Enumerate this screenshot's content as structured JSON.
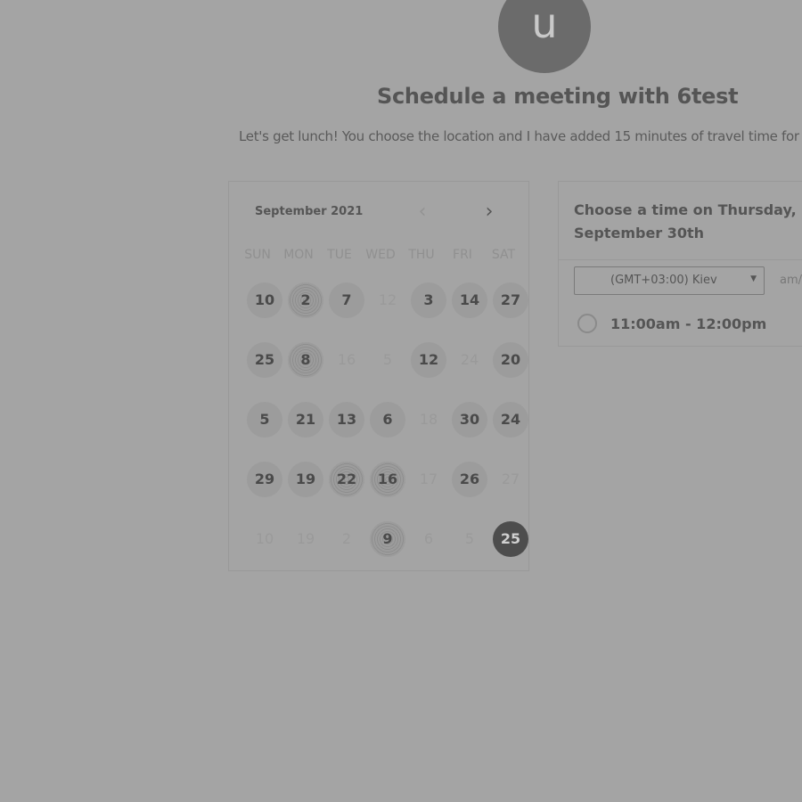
{
  "header": {
    "avatar_initial": "u",
    "title": "Schedule a meeting with 6test",
    "subtitle": "Let's get lunch! You choose the location and I have added 15 minutes of travel time for"
  },
  "calendar": {
    "month_label": "September 2021",
    "prev_icon": "chevron-left-icon",
    "next_icon": "chevron-right-icon",
    "weekdays": [
      "SUN",
      "MON",
      "TUE",
      "WED",
      "THU",
      "FRI",
      "SAT"
    ],
    "weeks": [
      [
        {
          "d": "10",
          "s": "avail"
        },
        {
          "d": "2",
          "s": "dotted"
        },
        {
          "d": "7",
          "s": "avail"
        },
        {
          "d": "12",
          "s": "off"
        },
        {
          "d": "3",
          "s": "avail"
        },
        {
          "d": "14",
          "s": "avail"
        },
        {
          "d": "27",
          "s": "avail"
        }
      ],
      [
        {
          "d": "25",
          "s": "avail"
        },
        {
          "d": "8",
          "s": "dotted"
        },
        {
          "d": "16",
          "s": "off"
        },
        {
          "d": "5",
          "s": "off"
        },
        {
          "d": "12",
          "s": "avail"
        },
        {
          "d": "24",
          "s": "off"
        },
        {
          "d": "20",
          "s": "avail"
        }
      ],
      [
        {
          "d": "5",
          "s": "avail"
        },
        {
          "d": "21",
          "s": "avail"
        },
        {
          "d": "13",
          "s": "avail"
        },
        {
          "d": "6",
          "s": "avail"
        },
        {
          "d": "18",
          "s": "off"
        },
        {
          "d": "30",
          "s": "avail"
        },
        {
          "d": "24",
          "s": "avail"
        }
      ],
      [
        {
          "d": "29",
          "s": "avail"
        },
        {
          "d": "19",
          "s": "avail"
        },
        {
          "d": "22",
          "s": "dotted"
        },
        {
          "d": "16",
          "s": "dotted"
        },
        {
          "d": "17",
          "s": "off"
        },
        {
          "d": "26",
          "s": "avail"
        },
        {
          "d": "27",
          "s": "off"
        }
      ],
      [
        {
          "d": "10",
          "s": "off"
        },
        {
          "d": "19",
          "s": "off"
        },
        {
          "d": "2",
          "s": "off"
        },
        {
          "d": "9",
          "s": "dotted"
        },
        {
          "d": "6",
          "s": "off"
        },
        {
          "d": "5",
          "s": "off"
        },
        {
          "d": "25",
          "s": "selected"
        }
      ]
    ]
  },
  "times": {
    "title": "Choose a time on Thursday, September 30th",
    "timezone": "(GMT+03:00) Kiev",
    "format_label": "am/",
    "slots": [
      {
        "label": "11:00am - 12:00pm"
      }
    ]
  },
  "colors": {
    "background": "#a4a4a4",
    "selected_day": "#4d4d4d",
    "available_day": "#9c9c9c"
  }
}
